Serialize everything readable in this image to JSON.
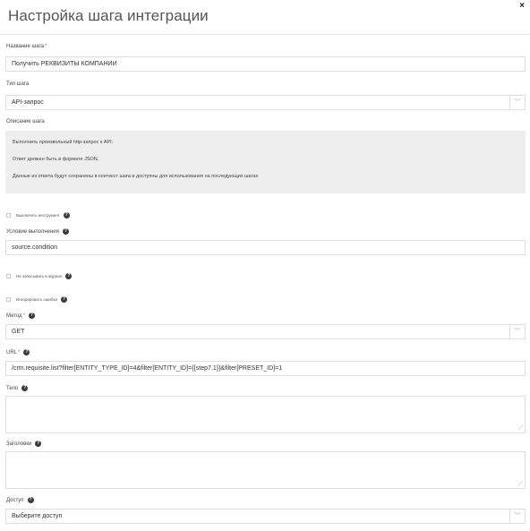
{
  "dialog": {
    "title": "Настройка шага интеграции",
    "close_icon": "close-icon",
    "close_glyph": "×"
  },
  "fields": {
    "step_name": {
      "label": "Название шага",
      "required_mark": "*",
      "value": "Получить РЕКВИЗИТЫ КОМПАНИИ"
    },
    "step_type": {
      "label": "Тип шага",
      "value": "API-запрос"
    },
    "description": {
      "label": "Описание шага",
      "lines": [
        "Выполнить произвольный http-запрос к API.",
        "Ответ должен быть в формате JSON.",
        "Данные из ответа будут сохранены в контекст шага и доступны для использования на последующих шагах"
      ]
    },
    "disable_tool": {
      "label": "Выключить инструмент"
    },
    "condition": {
      "label": "Условие выполнения",
      "value": "source.condition"
    },
    "no_log": {
      "label": "Не записывать в журнал"
    },
    "ignore_errors": {
      "label": "Игнорировать ошибки"
    },
    "method": {
      "label": "Метод",
      "required_mark": "*",
      "value": "GET"
    },
    "url": {
      "label": "URL",
      "required_mark": "*",
      "value": "/crm.requisite.list?filter[ENTITY_TYPE_ID]=4&filter[ENTITY_ID]={{step7.1}}&filter[PRESET_ID]=1"
    },
    "body": {
      "label": "Тело",
      "value": ""
    },
    "headers": {
      "label": "Заголовки",
      "value": ""
    },
    "access": {
      "label": "Доступ",
      "placeholder": "Выберите доступ"
    }
  },
  "icons": {
    "help": "?",
    "chevron_down": "﹀",
    "resize_grip": "⟋"
  }
}
